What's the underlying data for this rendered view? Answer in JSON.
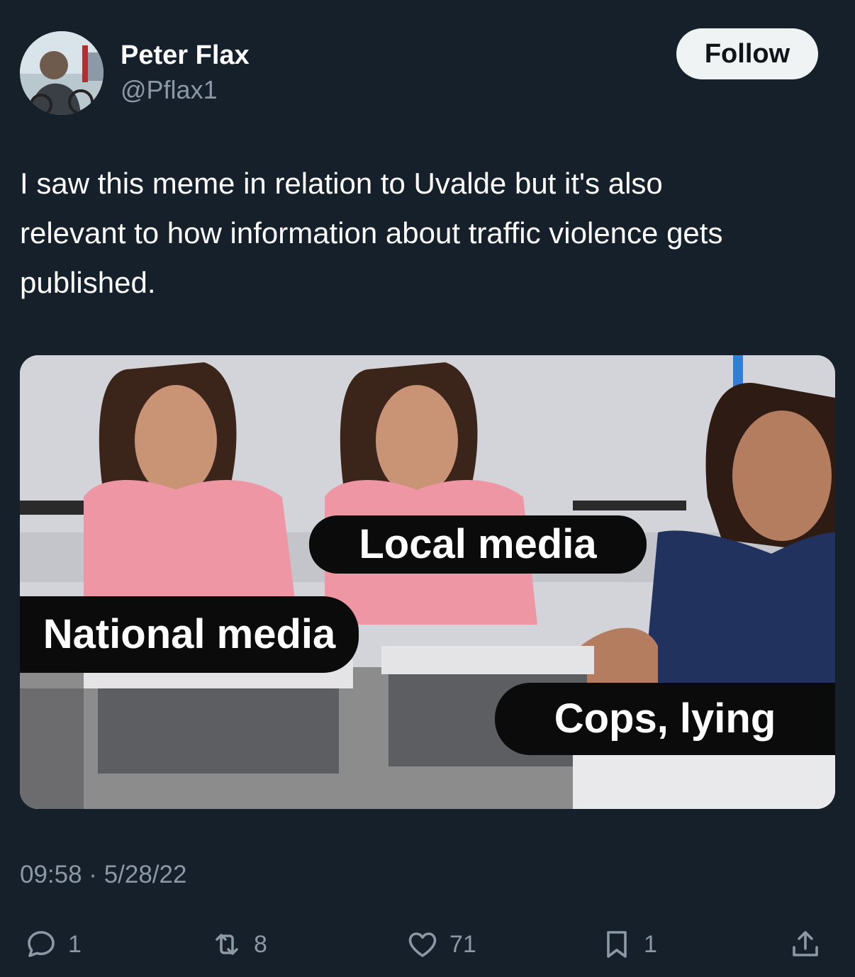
{
  "author": {
    "display_name": "Peter Flax",
    "handle": "@Pflax1"
  },
  "follow_label": "Follow",
  "tweet": {
    "text": "I saw this meme in relation to Uvalde but it's also\nrelevant  to how information about traffic violence gets\npublished."
  },
  "meme": {
    "labels": {
      "local": "Local media",
      "national": "National media",
      "cops": "Cops, lying"
    }
  },
  "timestamp": "09:58 · 5/28/22",
  "actions": {
    "replies": "1",
    "retweets": "8",
    "likes": "71",
    "bookmarks": "1"
  },
  "colors": {
    "background": "#15202b",
    "muted_text": "#8b98a5",
    "follow_button": "#eff3f4"
  },
  "icons": [
    "reply-icon",
    "retweet-icon",
    "heart-icon",
    "bookmark-icon",
    "share-icon"
  ]
}
